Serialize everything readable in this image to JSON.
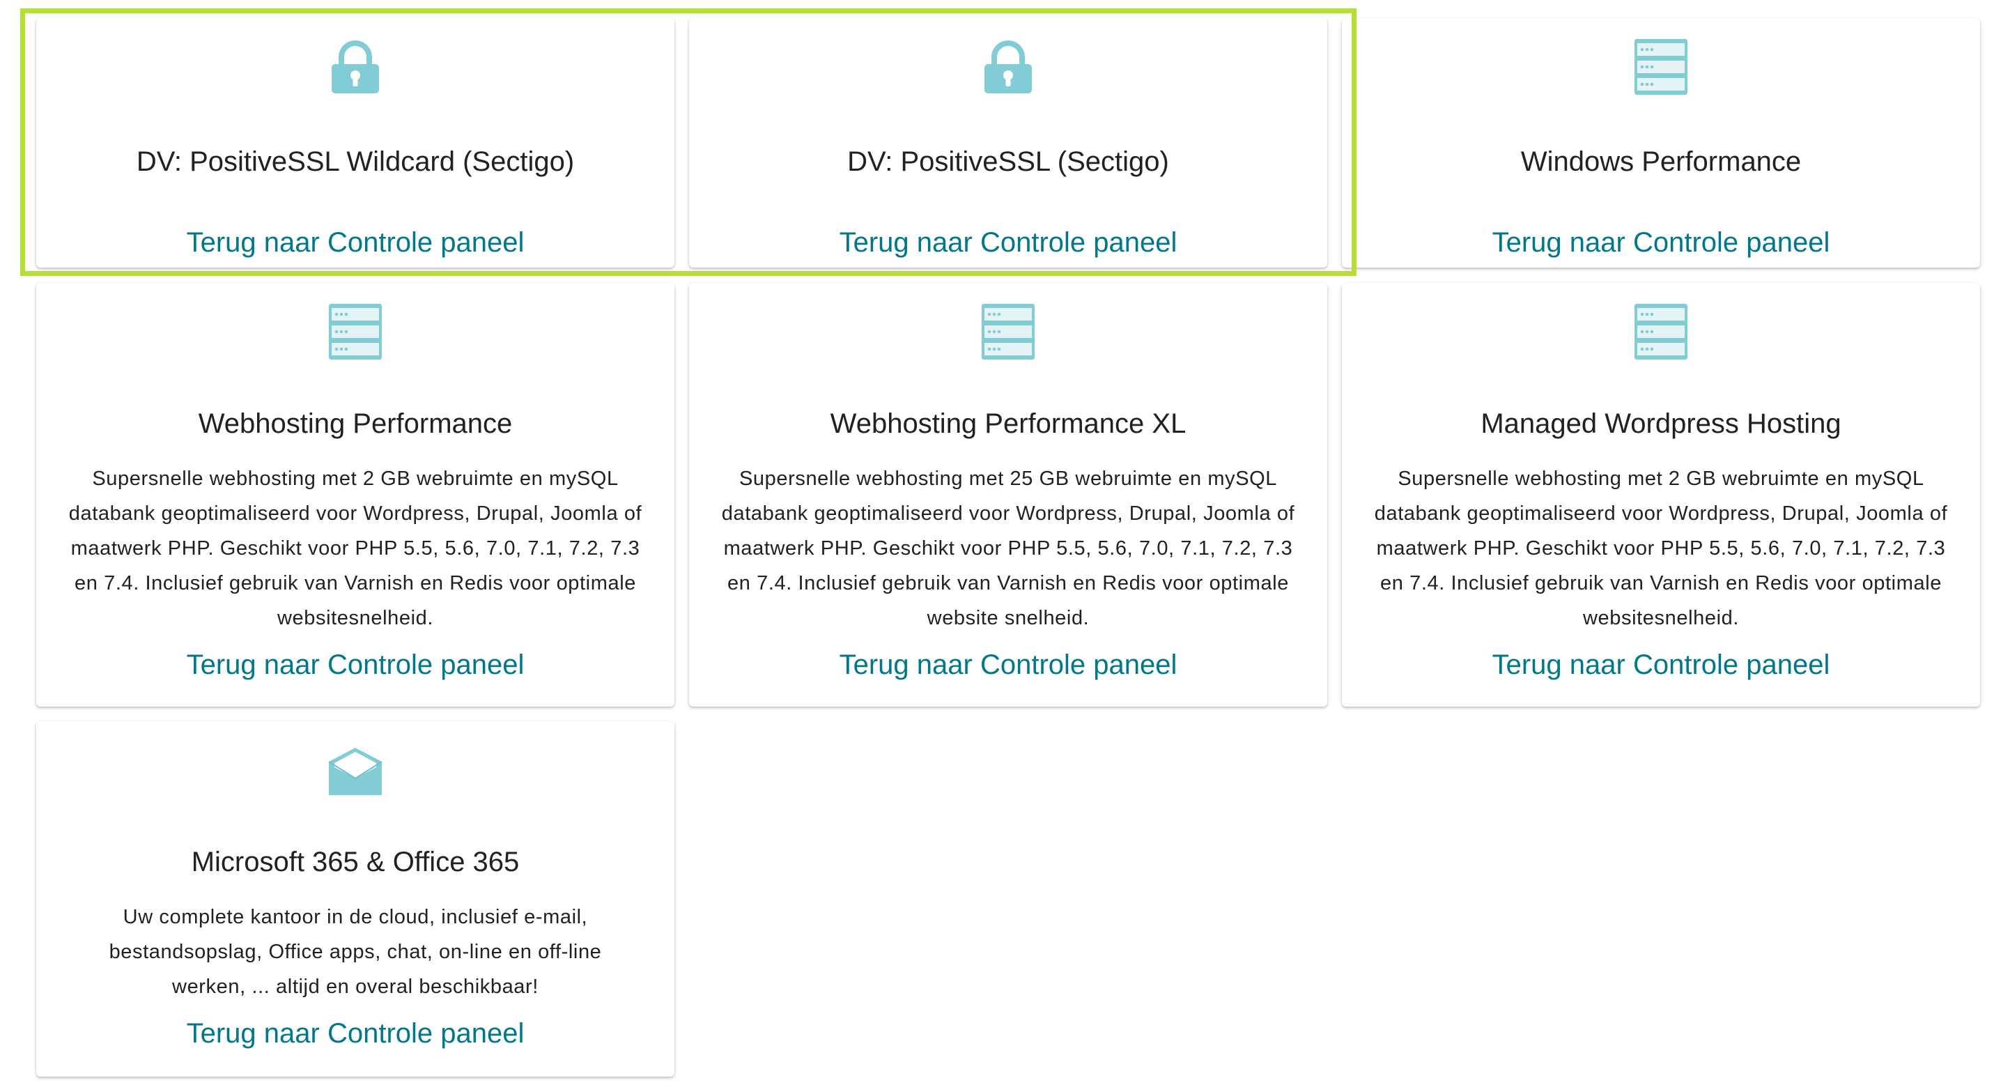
{
  "accent_color": "#00778a",
  "icon_color": "#82cdd5",
  "highlight_color": "#b5e033",
  "products": [
    {
      "icon": "lock-icon",
      "title": "DV: PositiveSSL Wildcard (Sectigo)",
      "description": "",
      "link": "Terug naar Controle paneel"
    },
    {
      "icon": "lock-icon",
      "title": "DV: PositiveSSL (Sectigo)",
      "description": "",
      "link": "Terug naar Controle paneel"
    },
    {
      "icon": "server-icon",
      "title": "Windows Performance",
      "description": "",
      "link": "Terug naar Controle paneel"
    },
    {
      "icon": "server-icon",
      "title": "Webhosting Performance",
      "description": "Supersnelle webhosting met 2 GB webruimte en mySQL databank geoptimaliseerd voor Wordpress, Drupal, Joomla of maatwerk PHP. Geschikt voor PHP 5.5, 5.6, 7.0, 7.1, 7.2, 7.3 en 7.4. Inclusief gebruik van Varnish en Redis voor optimale websitesnelheid.",
      "link": "Terug naar Controle paneel"
    },
    {
      "icon": "server-icon",
      "title": "Webhosting Performance XL",
      "description": "Supersnelle webhosting met 25 GB webruimte en mySQL databank geoptimaliseerd voor Wordpress, Drupal, Joomla of maatwerk PHP. Geschikt voor PHP 5.5, 5.6, 7.0, 7.1, 7.2, 7.3 en 7.4. Inclusief gebruik van Varnish en Redis voor optimale website snelheid.",
      "link": "Terug naar Controle paneel"
    },
    {
      "icon": "server-icon",
      "title": "Managed Wordpress Hosting",
      "description": "Supersnelle webhosting met 2 GB webruimte en mySQL databank geoptimaliseerd voor Wordpress, Drupal, Joomla of maatwerk PHP. Geschikt voor PHP 5.5, 5.6, 7.0, 7.1, 7.2, 7.3 en 7.4. Inclusief gebruik van Varnish en Redis voor optimale websitesnelheid.",
      "link": "Terug naar Controle paneel"
    },
    {
      "icon": "envelope-icon",
      "title": "Microsoft 365 & Office 365",
      "description": "Uw complete kantoor in de cloud, inclusief e-mail, bestandsopslag, Office apps, chat, on-line en off-line werken, ... altijd en overal beschikbaar!",
      "link": "Terug naar Controle paneel"
    }
  ]
}
